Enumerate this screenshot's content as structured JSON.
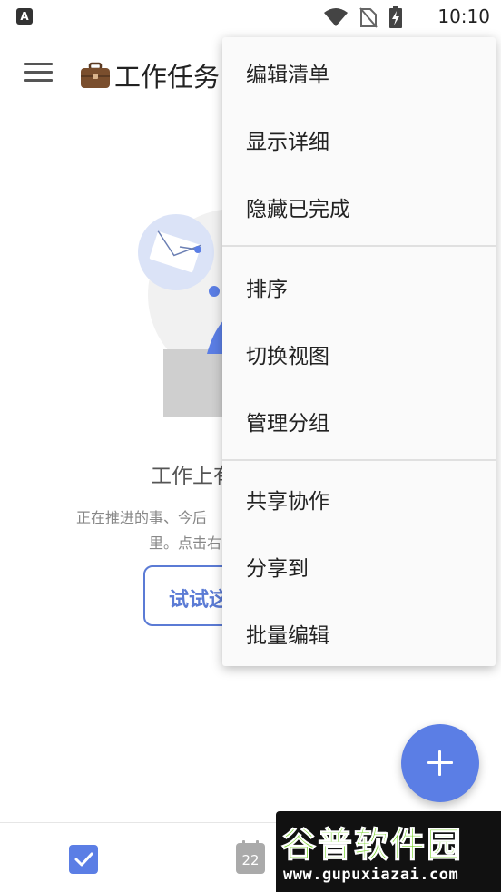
{
  "status_bar": {
    "app_badge": "A",
    "time": "10:10",
    "icons": [
      "wifi-icon",
      "no-sim-icon",
      "battery-charging-icon"
    ]
  },
  "app_bar": {
    "title": "工作任务",
    "title_emoji": "briefcase-icon"
  },
  "empty_state": {
    "title": "工作上有",
    "description_line1": "正在推进的事、今后",
    "description_line2": "里。点击右",
    "try_button": "试试这"
  },
  "menu": {
    "groups": [
      [
        "编辑清单",
        "显示详细",
        "隐藏已完成"
      ],
      [
        "排序",
        "切换视图",
        "管理分组"
      ],
      [
        "共享协作",
        "分享到",
        "批量编辑"
      ]
    ]
  },
  "bottom_nav": {
    "tasks_icon": "checkbox-icon",
    "calendar_day": "22"
  },
  "watermark": {
    "name": "谷普软件园",
    "url": "www.gupuxiazai.com"
  },
  "colors": {
    "accent": "#5b7ee5",
    "watermark_green": "#6fd11c"
  }
}
